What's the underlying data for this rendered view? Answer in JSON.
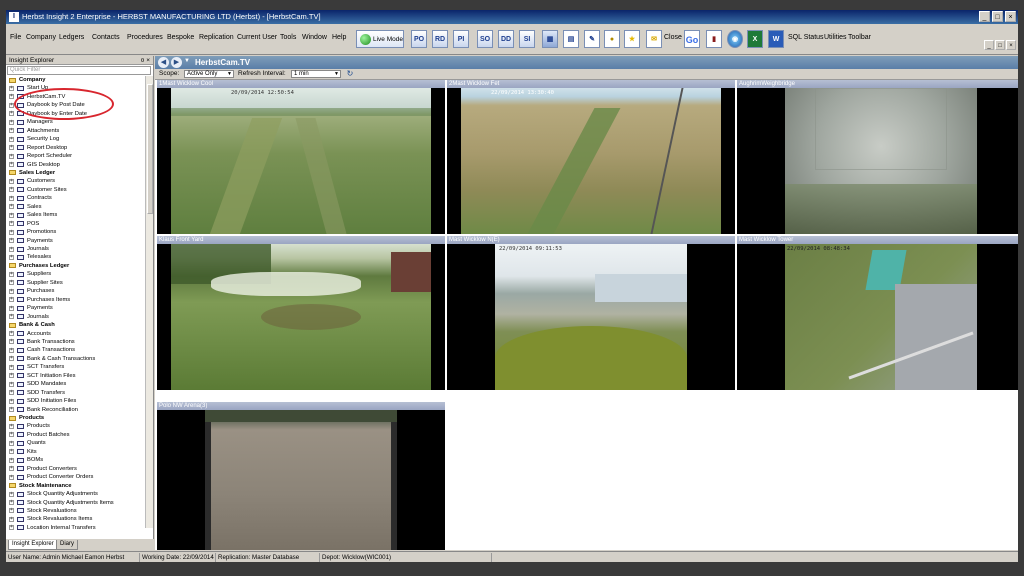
{
  "window": {
    "title": "Herbst Insight 2 Enterprise - HERBST MANUFACTURING LTD (Herbst) - [HerbstCam.TV]",
    "app_icon": "I"
  },
  "menu": {
    "items": [
      "File",
      "Company",
      "Ledgers",
      "Contacts",
      "Procedures",
      "Bespoke",
      "Replication",
      "Current User",
      "Tools",
      "Window",
      "Help"
    ],
    "live_mode": "Live Mode",
    "toolbar_icons": [
      "PO",
      "RD",
      "PI",
      "SO",
      "DD",
      "SI"
    ],
    "close": "Close",
    "go": "Go",
    "trailing": [
      "SQL Status",
      "Utilities",
      "Toolbar"
    ]
  },
  "explorer": {
    "title": "Insight Explorer",
    "controls": "¤ ×",
    "filter_placeholder": "Quick Filter",
    "tree": [
      {
        "label": "Company",
        "cat": true
      },
      {
        "label": "Start Up"
      },
      {
        "label": "HerbstCam.TV"
      },
      {
        "label": "Daybook by Post Date"
      },
      {
        "label": "Daybook by Enter Date"
      },
      {
        "label": "Managers"
      },
      {
        "label": "Attachments"
      },
      {
        "label": "Security Log"
      },
      {
        "label": "Report Desktop"
      },
      {
        "label": "Report Scheduler"
      },
      {
        "label": "GIS Desktop"
      },
      {
        "label": "Sales Ledger",
        "cat": true
      },
      {
        "label": "Customers"
      },
      {
        "label": "Customer Sites"
      },
      {
        "label": "Contracts"
      },
      {
        "label": "Sales"
      },
      {
        "label": "Sales Items"
      },
      {
        "label": "POS"
      },
      {
        "label": "Promotions"
      },
      {
        "label": "Payments"
      },
      {
        "label": "Journals"
      },
      {
        "label": "Telesales"
      },
      {
        "label": "Purchases Ledger",
        "cat": true
      },
      {
        "label": "Suppliers"
      },
      {
        "label": "Supplier Sites"
      },
      {
        "label": "Purchases"
      },
      {
        "label": "Purchases Items"
      },
      {
        "label": "Payments"
      },
      {
        "label": "Journals"
      },
      {
        "label": "Bank & Cash",
        "cat": true
      },
      {
        "label": "Accounts"
      },
      {
        "label": "Bank Transactions"
      },
      {
        "label": "Cash Transactions"
      },
      {
        "label": "Bank & Cash Transactions"
      },
      {
        "label": "SCT Transfers"
      },
      {
        "label": "SCT Initiation Files"
      },
      {
        "label": "SDD Mandates"
      },
      {
        "label": "SDD Transfers"
      },
      {
        "label": "SDD Initiation Files"
      },
      {
        "label": "Bank Reconciliation"
      },
      {
        "label": "Products",
        "cat": true
      },
      {
        "label": "Products"
      },
      {
        "label": "Product Batches"
      },
      {
        "label": "Quants"
      },
      {
        "label": "Kits"
      },
      {
        "label": "BOMs"
      },
      {
        "label": "Product Converters"
      },
      {
        "label": "Product Converter Orders"
      },
      {
        "label": "Stock Maintenance",
        "cat": true
      },
      {
        "label": "Stock Quantity Adjustments"
      },
      {
        "label": "Stock Quantity Adjustments Items"
      },
      {
        "label": "Stock Revaluations"
      },
      {
        "label": "Stock Revaluations Items"
      },
      {
        "label": "Location Internal Transfers"
      }
    ],
    "tabs": [
      "Insight Explorer",
      "Diary"
    ]
  },
  "cam": {
    "title": "HerbstCam.TV",
    "scope_label": "Scope:",
    "scope_value": "Active Only",
    "interval_label": "Refresh Interval:",
    "interval_value": "1 min",
    "feeds": [
      {
        "caption": "1Mast Wicklow Cool",
        "stamp": "20/09/2014 12:50:54"
      },
      {
        "caption": "2Mast Wicklow Fet",
        "stamp": "22/09/2014 13:30:40"
      },
      {
        "caption": "AughrimWeighbridge",
        "stamp": ""
      },
      {
        "caption": "Klaus Front Yard",
        "stamp": ""
      },
      {
        "caption": "Mast Wicklow N(E)",
        "stamp": "22/09/2014 09:11:53"
      },
      {
        "caption": "Mast Wicklow Tower",
        "stamp": "22/09/2014 08:48:34"
      },
      {
        "caption": "Polo NW Arena(3)",
        "stamp": ""
      }
    ]
  },
  "status": {
    "user": "User Name: Admin Michael Eamon Herbst",
    "working_date": "Working Date: 22/09/2014",
    "replication": "Replication: Master Database",
    "depot": "Depot: Wicklow(WIC001)"
  },
  "colors": {
    "title_bar": "#0a246a",
    "annotation_circle": "#d8262e",
    "cam_tab": "#5a7ea8"
  }
}
